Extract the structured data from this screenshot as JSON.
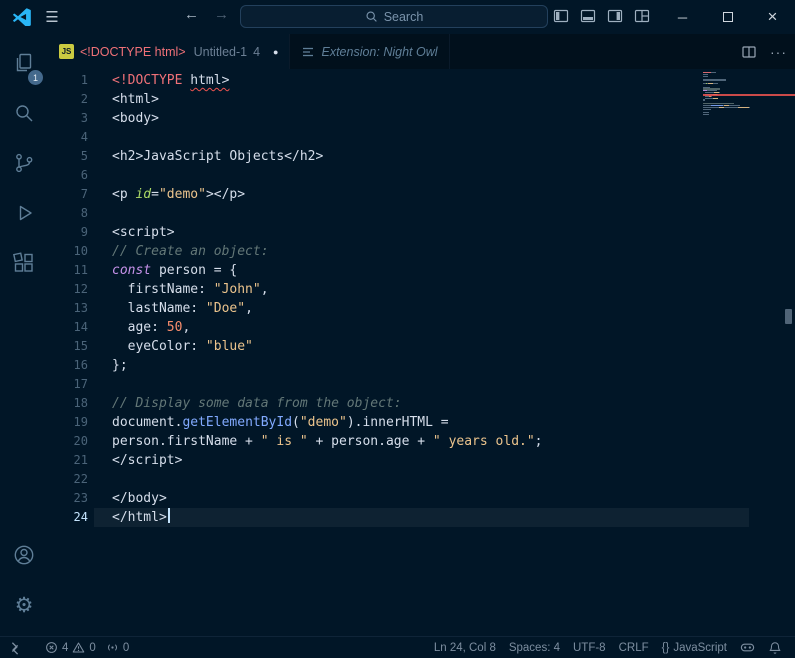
{
  "colors": {
    "background": "#011627",
    "foreground": "#d6deeb",
    "logo_blue": "#29b6f6",
    "error_red": "#ef5350",
    "tab_error_label": "#f07178",
    "string_orange": "#ecc48d",
    "badge_blue": "#44698c",
    "muted_icon": "#5f7e97"
  },
  "titlebar": {
    "menu_icon": "☰",
    "back_arrow": "←",
    "forward_arrow": "→",
    "search_placeholder": "Search",
    "minimize_icon": "─",
    "close_icon": "×"
  },
  "activitybar": {
    "explorer_badge": "1"
  },
  "tabs": {
    "active": {
      "icon_label": "JS",
      "title": "<!DOCTYPE html>",
      "description": "Untitled-1",
      "error_badge": "4",
      "modified_dot": "●"
    },
    "preview": {
      "title": "Extension: Night Owl"
    },
    "actions_more": "···"
  },
  "editor": {
    "active_line": 24,
    "lines": [
      {
        "num": 1,
        "tokens": [
          [
            "<!DOCTYPE",
            "doctype"
          ],
          [
            " ",
            "plain"
          ],
          [
            "html>",
            "plain err"
          ]
        ]
      },
      {
        "num": 2,
        "tokens": [
          [
            "<html>",
            "plain"
          ]
        ]
      },
      {
        "num": 3,
        "tokens": [
          [
            "<body>",
            "plain"
          ]
        ]
      },
      {
        "num": 4,
        "tokens": []
      },
      {
        "num": 5,
        "tokens": [
          [
            "<h2>JavaScript Objects</h2>",
            "plain"
          ]
        ]
      },
      {
        "num": 6,
        "tokens": []
      },
      {
        "num": 7,
        "tokens": [
          [
            "<p ",
            "plain"
          ],
          [
            "id",
            "attr"
          ],
          [
            "=",
            "plain"
          ],
          [
            "\"demo\"",
            "str"
          ],
          [
            "></p>",
            "plain"
          ]
        ]
      },
      {
        "num": 8,
        "tokens": []
      },
      {
        "num": 9,
        "tokens": [
          [
            "<script>",
            "plain"
          ]
        ]
      },
      {
        "num": 10,
        "tokens": [
          [
            "// Create an object:",
            "comment"
          ]
        ]
      },
      {
        "num": 11,
        "tokens": [
          [
            "const",
            "kw"
          ],
          [
            " person = {",
            "plain"
          ]
        ]
      },
      {
        "num": 12,
        "tokens": [
          [
            "  firstName: ",
            "plain"
          ],
          [
            "\"John\"",
            "str"
          ],
          [
            ",",
            "plain"
          ]
        ]
      },
      {
        "num": 13,
        "tokens": [
          [
            "  lastName: ",
            "plain"
          ],
          [
            "\"Doe\"",
            "str"
          ],
          [
            ",",
            "plain"
          ]
        ]
      },
      {
        "num": 14,
        "tokens": [
          [
            "  age: ",
            "plain"
          ],
          [
            "50",
            "num"
          ],
          [
            ",",
            "plain"
          ]
        ]
      },
      {
        "num": 15,
        "tokens": [
          [
            "  eyeColor: ",
            "plain"
          ],
          [
            "\"blue\"",
            "str"
          ]
        ]
      },
      {
        "num": 16,
        "tokens": [
          [
            "};",
            "plain"
          ]
        ]
      },
      {
        "num": 17,
        "tokens": []
      },
      {
        "num": 18,
        "tokens": [
          [
            "// Display some data from the object:",
            "comment"
          ]
        ]
      },
      {
        "num": 19,
        "tokens": [
          [
            "document.",
            "plain"
          ],
          [
            "getElementById",
            "fn"
          ],
          [
            "(",
            "plain"
          ],
          [
            "\"demo\"",
            "str"
          ],
          [
            ").innerHTML =",
            "plain"
          ]
        ]
      },
      {
        "num": 20,
        "tokens": [
          [
            "person.firstName + ",
            "plain"
          ],
          [
            "\" is \"",
            "str"
          ],
          [
            " + person.age + ",
            "plain"
          ],
          [
            "\" years old.\"",
            "str"
          ],
          [
            ";",
            "plain"
          ]
        ]
      },
      {
        "num": 21,
        "tokens": [
          [
            "</script>",
            "plain"
          ]
        ]
      },
      {
        "num": 22,
        "tokens": []
      },
      {
        "num": 23,
        "tokens": [
          [
            "</body>",
            "plain"
          ]
        ]
      },
      {
        "num": 24,
        "tokens": [
          [
            "</html>",
            "plain"
          ]
        ]
      }
    ]
  },
  "statusbar": {
    "errors": "4",
    "warnings": "0",
    "ports": "0",
    "cursor_position": "Ln 24, Col 8",
    "indentation": "Spaces: 4",
    "encoding": "UTF-8",
    "eol": "CRLF",
    "braces": "{}",
    "language": "JavaScript"
  }
}
